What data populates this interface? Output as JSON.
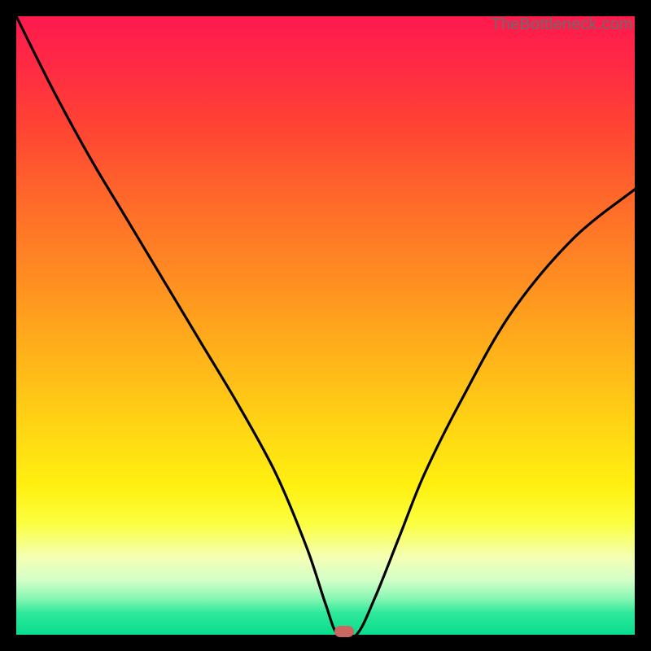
{
  "watermark": "TheBottleneck.com",
  "colors": {
    "frame": "#000000",
    "curve": "#000000",
    "marker": "#cc6660",
    "gradient_top": "#ff1a4d",
    "gradient_bottom": "#09dd8e"
  },
  "chart_data": {
    "type": "line",
    "title": "",
    "xlabel": "",
    "ylabel": "",
    "xlim": [
      0,
      100
    ],
    "ylim": [
      0,
      100
    ],
    "annotations": [
      {
        "type": "marker",
        "x": 53,
        "y": 0.5,
        "shape": "rounded-rect",
        "color": "#cc6660"
      }
    ],
    "series": [
      {
        "name": "curve",
        "x": [
          0,
          6,
          12,
          18,
          24,
          30,
          36,
          42,
          47,
          50,
          52,
          55,
          58,
          62,
          66,
          72,
          80,
          90,
          100
        ],
        "y": [
          100,
          88,
          77,
          67,
          57,
          47,
          37,
          26,
          14,
          5,
          0,
          0,
          6,
          16,
          26,
          38,
          52,
          64,
          72
        ]
      }
    ]
  }
}
